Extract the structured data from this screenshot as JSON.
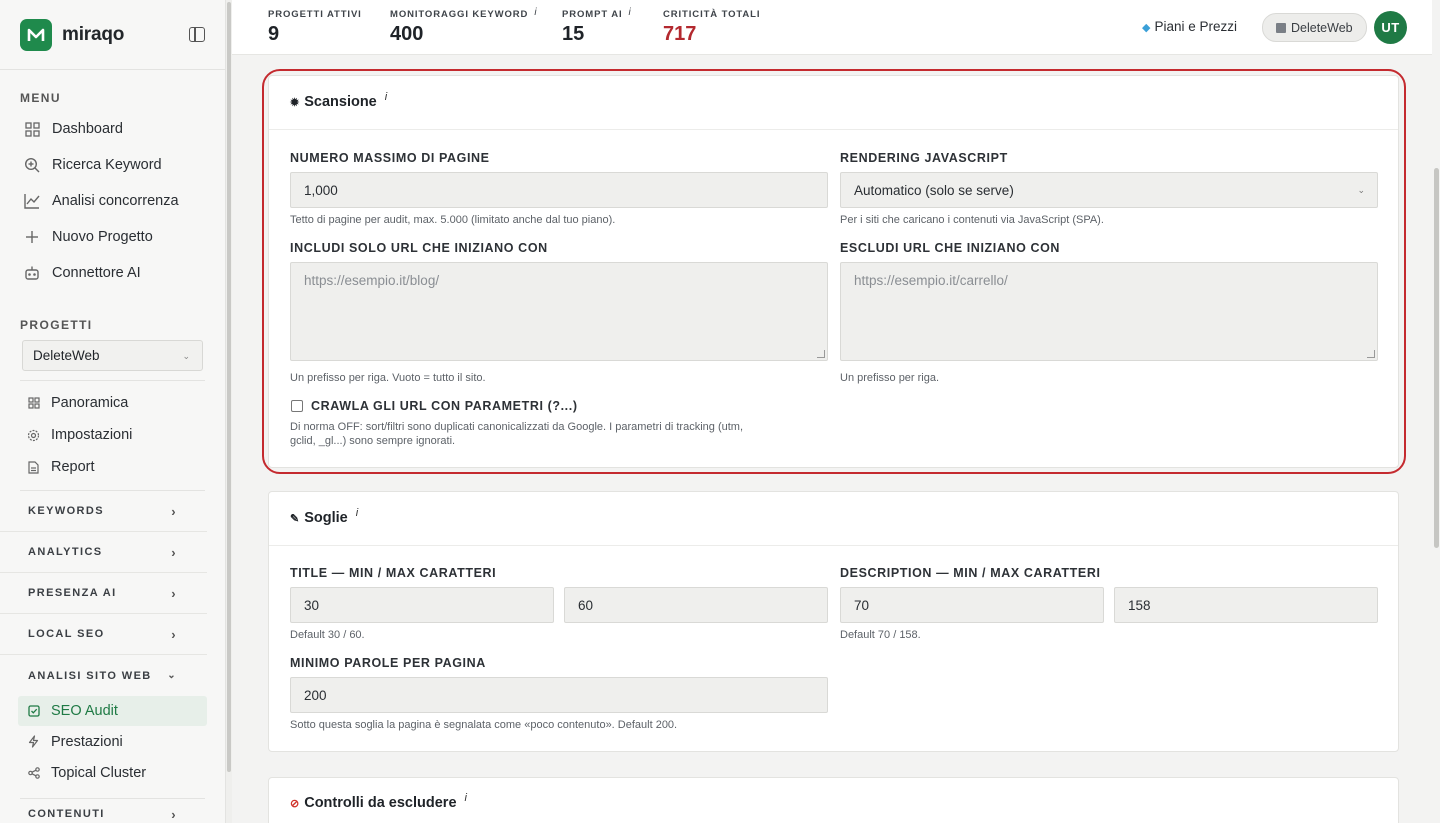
{
  "brand": {
    "name": "miraqo",
    "logo_letter": "M"
  },
  "sidebar": {
    "menu_label": "MENU",
    "menu_items": [
      {
        "label": "Dashboard",
        "icon": "grid-icon"
      },
      {
        "label": "Ricerca Keyword",
        "icon": "search-icon"
      },
      {
        "label": "Analisi concorrenza",
        "icon": "chart-line-icon"
      },
      {
        "label": "Nuovo Progetto",
        "icon": "plus-icon"
      },
      {
        "label": "Connettore AI",
        "icon": "bot-icon"
      }
    ],
    "projects_label": "PROGETTI",
    "project_selected": "DeleteWeb",
    "project_items": [
      {
        "label": "Panoramica",
        "icon": "grid-icon"
      },
      {
        "label": "Impostazioni",
        "icon": "gear-icon"
      },
      {
        "label": "Report",
        "icon": "file-icon"
      }
    ],
    "groups": [
      {
        "label": "KEYWORDS"
      },
      {
        "label": "ANALYTICS"
      },
      {
        "label": "PRESENZA AI"
      },
      {
        "label": "LOCAL SEO"
      }
    ],
    "open_group": {
      "label": "ANALISI SITO WEB",
      "items": [
        {
          "label": "SEO Audit",
          "icon": "checkbox-icon",
          "active": true
        },
        {
          "label": "Prestazioni",
          "icon": "bolt-icon"
        },
        {
          "label": "Topical Cluster",
          "icon": "share-icon"
        }
      ]
    },
    "last_group": {
      "label": "CONTENUTI"
    }
  },
  "topbar": {
    "stats": [
      {
        "label": "PROGETTI ATTIVI",
        "value": "9",
        "info": false
      },
      {
        "label": "MONITORAGGI KEYWORD",
        "value": "400",
        "info": true
      },
      {
        "label": "PROMPT AI",
        "value": "15",
        "info": true
      },
      {
        "label": "CRITICITÀ TOTALI",
        "value": "717",
        "info": false
      }
    ],
    "plans_label": "Piani e Prezzi",
    "workspace_label": "DeleteWeb",
    "avatar_initials": "UT"
  },
  "scan": {
    "title": "Scansione",
    "max_pages": {
      "label": "NUMERO MASSIMO DI PAGINE",
      "value": "1,000",
      "help": "Tetto di pagine per audit, max. 5.000 (limitato anche dal tuo piano)."
    },
    "js_rendering": {
      "label": "RENDERING JAVASCRIPT",
      "value": "Automatico (solo se serve)",
      "help": "Per i siti che caricano i contenuti via JavaScript (SPA)."
    },
    "include": {
      "label": "INCLUDI SOLO URL CHE INIZIANO CON",
      "placeholder": "https://esempio.it/blog/",
      "help": "Un prefisso per riga. Vuoto = tutto il sito."
    },
    "exclude": {
      "label": "ESCLUDI URL CHE INIZIANO CON",
      "placeholder": "https://esempio.it/carrello/",
      "help": "Un prefisso per riga."
    },
    "params": {
      "label": "CRAWLA GLI URL CON PARAMETRI (?...)",
      "help_line1": "Di norma OFF: sort/filtri sono duplicati canonicalizzati da Google. I parametri di tracking (utm,",
      "help_line2": "gclid, _gl...) sono sempre ignorati.",
      "checked": false
    }
  },
  "thresholds": {
    "title": "Soglie",
    "title_len": {
      "label": "TITLE — MIN / MAX CARATTERI",
      "min": "30",
      "max": "60",
      "help": "Default 30 / 60."
    },
    "desc_len": {
      "label": "DESCRIPTION — MIN / MAX CARATTERI",
      "min": "70",
      "max": "158",
      "help": "Default 70 / 158."
    },
    "min_words": {
      "label": "MINIMO PAROLE PER PAGINA",
      "value": "200",
      "help": "Sotto questa soglia la pagina è segnalata come «poco contenuto». Default 200."
    }
  },
  "excluded_checks": {
    "title": "Controlli da escludere"
  },
  "colors": {
    "brand_green": "#1f8a4c",
    "critical_red": "#b3292f",
    "highlight_red": "#c42a2f"
  }
}
